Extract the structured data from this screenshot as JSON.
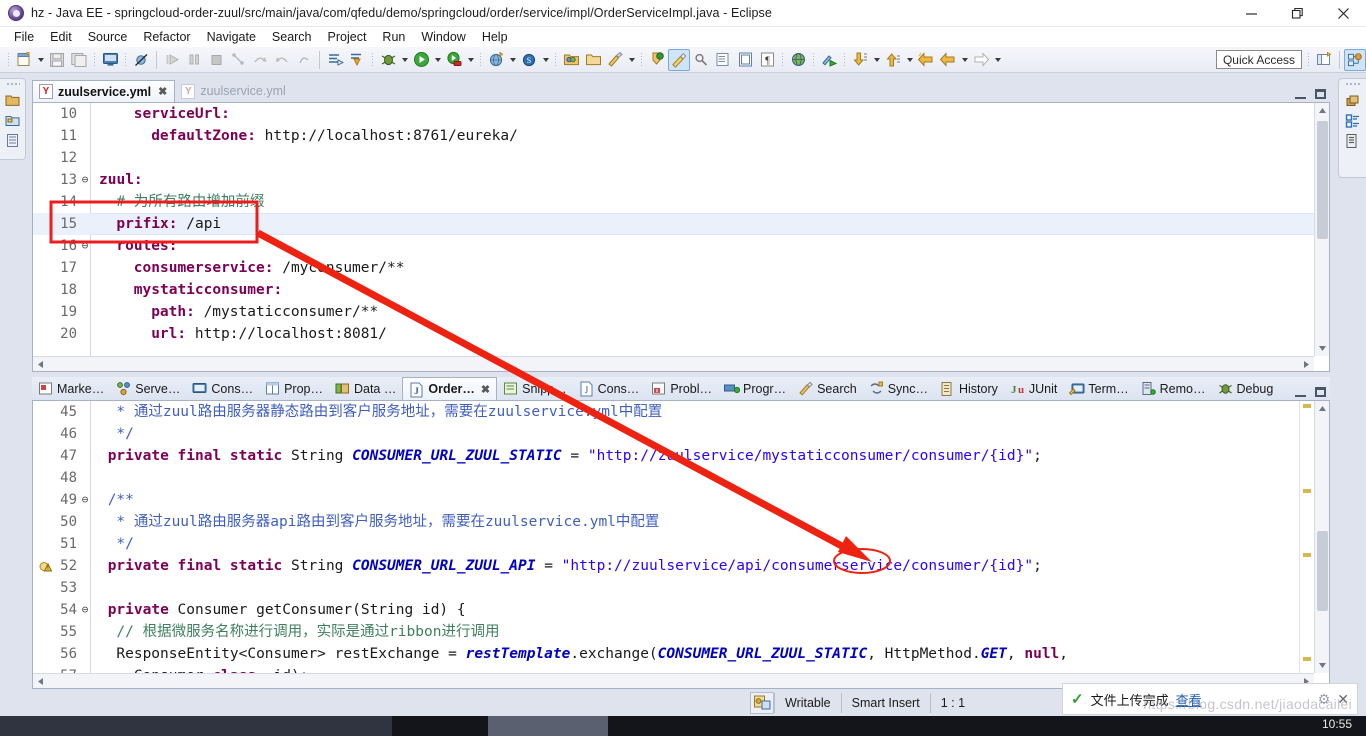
{
  "window": {
    "title": "hz - Java EE - springcloud-order-zuul/src/main/java/com/qfedu/demo/springcloud/order/service/impl/OrderServiceImpl.java - Eclipse",
    "app_icon": "eclipse-icon",
    "minimize_label": "minimize-icon",
    "maximize_label": "restore-icon",
    "close_label": "close-icon"
  },
  "menu": {
    "items": [
      {
        "label": "File"
      },
      {
        "label": "Edit"
      },
      {
        "label": "Source"
      },
      {
        "label": "Refactor"
      },
      {
        "label": "Navigate"
      },
      {
        "label": "Search"
      },
      {
        "label": "Project"
      },
      {
        "label": "Run"
      },
      {
        "label": "Window"
      },
      {
        "label": "Help"
      }
    ]
  },
  "toolbar": {
    "quick_access_label": "Quick Access",
    "buttons": [
      {
        "name": "new-wizard-icon"
      },
      {
        "name": "save-icon"
      },
      {
        "name": "save-all-icon"
      },
      {
        "name": "new-java-ee-icon"
      },
      {
        "name": "skip-all-breakpoints-icon"
      },
      {
        "name": "resume-icon"
      },
      {
        "name": "suspend-icon"
      },
      {
        "name": "terminate-icon"
      },
      {
        "name": "step-into-icon"
      },
      {
        "name": "step-over-icon"
      },
      {
        "name": "step-return-icon"
      },
      {
        "name": "drop-to-frame-icon"
      },
      {
        "name": "next-annotation-icon"
      },
      {
        "name": "previous-annotation-icon"
      },
      {
        "name": "debug-icon"
      },
      {
        "name": "run-icon"
      },
      {
        "name": "run-configurations-icon"
      },
      {
        "name": "new-web-project-icon"
      },
      {
        "name": "new-spring-element-icon"
      },
      {
        "name": "open-type-icon"
      },
      {
        "name": "open-task-icon"
      },
      {
        "name": "external-tools-icon"
      },
      {
        "name": "pin-editor-icon"
      },
      {
        "name": "toggle-mark-occurrences-icon"
      },
      {
        "name": "search-icon"
      },
      {
        "name": "open-perspective-icon"
      },
      {
        "name": "java-ee-perspective-icon"
      }
    ]
  },
  "left_fast_view": {
    "icons": [
      "project-explorer-icon",
      "package-explorer-icon",
      "servers-icon"
    ]
  },
  "right_fast_view": {
    "icons": [
      "restore-view-icon",
      "outline-icon",
      "task-list-icon"
    ]
  },
  "editor": {
    "tabs": [
      {
        "label": "zuulservice.yml",
        "icon": "yaml-file-icon",
        "selected": true,
        "closable": true
      },
      {
        "label": "zuulservice.yml",
        "icon": "yaml-file-icon",
        "selected": false,
        "closable": false
      }
    ],
    "minimize_tooltip": "Minimize",
    "maximize_tooltip": "Maximize",
    "lines": [
      {
        "no": "10",
        "fold": "",
        "indent": 4,
        "segs": [
          {
            "t": "serviceUrl:",
            "c": "k"
          }
        ]
      },
      {
        "no": "11",
        "fold": "",
        "indent": 6,
        "segs": [
          {
            "t": "defaultZone:",
            "c": "k"
          },
          {
            "t": " http://localhost:8761/eureka/",
            "c": "v"
          }
        ]
      },
      {
        "no": "12",
        "fold": "",
        "indent": 0,
        "segs": []
      },
      {
        "no": "13",
        "fold": "⊖",
        "indent": 0,
        "segs": [
          {
            "t": "zuul:",
            "c": "k"
          }
        ]
      },
      {
        "no": "14",
        "fold": "",
        "indent": 2,
        "segs": [
          {
            "t": "# 为所有路由增加前缀",
            "c": "cm"
          }
        ]
      },
      {
        "no": "15",
        "fold": "",
        "indent": 2,
        "segs": [
          {
            "t": "prifix:",
            "c": "k"
          },
          {
            "t": " /api",
            "c": "v"
          }
        ],
        "highlight": true
      },
      {
        "no": "16",
        "fold": "⊖",
        "indent": 2,
        "segs": [
          {
            "t": "routes:",
            "c": "k"
          }
        ]
      },
      {
        "no": "17",
        "fold": "",
        "indent": 4,
        "segs": [
          {
            "t": "consumerservice:",
            "c": "k"
          },
          {
            "t": " /myconsumer/**",
            "c": "v"
          }
        ]
      },
      {
        "no": "18",
        "fold": "",
        "indent": 4,
        "segs": [
          {
            "t": "mystaticconsumer:",
            "c": "k"
          }
        ]
      },
      {
        "no": "19",
        "fold": "",
        "indent": 6,
        "segs": [
          {
            "t": "path:",
            "c": "k"
          },
          {
            "t": " /mystaticconsumer/**",
            "c": "v"
          }
        ]
      },
      {
        "no": "20",
        "fold": "",
        "indent": 6,
        "segs": [
          {
            "t": "url:",
            "c": "k"
          },
          {
            "t": " http://localhost:8081/",
            "c": "v"
          }
        ]
      }
    ]
  },
  "bottom_panel": {
    "tabs": [
      {
        "label": "Marke…",
        "icon": "markers-icon",
        "selected": false
      },
      {
        "label": "Serve…",
        "icon": "servers-icon",
        "selected": false
      },
      {
        "label": "Cons…",
        "icon": "console-icon",
        "selected": false
      },
      {
        "label": "Prop…",
        "icon": "properties-icon",
        "selected": false
      },
      {
        "label": "Data …",
        "icon": "data-source-explorer-icon",
        "selected": false
      },
      {
        "label": "Order…",
        "icon": "java-file-icon",
        "selected": true,
        "closable": true
      },
      {
        "label": "Snipp…",
        "icon": "snippets-icon",
        "selected": false
      },
      {
        "label": "Cons…",
        "icon": "console-java-icon",
        "selected": false
      },
      {
        "label": "Probl…",
        "icon": "problems-icon",
        "selected": false
      },
      {
        "label": "Progr…",
        "icon": "progress-icon",
        "selected": false
      },
      {
        "label": "Search",
        "icon": "search-view-icon",
        "selected": false
      },
      {
        "label": "Sync…",
        "icon": "synchronize-icon",
        "selected": false
      },
      {
        "label": "History",
        "icon": "history-icon",
        "selected": false
      },
      {
        "label": "JUnit",
        "icon": "junit-icon",
        "selected": false
      },
      {
        "label": "Term…",
        "icon": "terminal-icon",
        "selected": false
      },
      {
        "label": "Remo…",
        "icon": "remote-systems-icon",
        "selected": false
      },
      {
        "label": "Debug",
        "icon": "debug-view-icon",
        "selected": false
      }
    ],
    "lines": [
      {
        "no": "45",
        "fold": "",
        "marker": "",
        "indent": 2,
        "segs": [
          {
            "t": "* 通过zuul路由服务器静态路由到客户服务地址，需要在zuulservice.yml中配置",
            "c": "jdoc"
          }
        ]
      },
      {
        "no": "46",
        "fold": "",
        "marker": "",
        "indent": 2,
        "segs": [
          {
            "t": "*/",
            "c": "jdoc"
          }
        ]
      },
      {
        "no": "47",
        "fold": "",
        "marker": "",
        "indent": 1,
        "segs": [
          {
            "t": "private final static",
            "c": "k"
          },
          {
            "t": " String ",
            "c": "v"
          },
          {
            "t": "CONSUMER_URL_ZUUL_STATIC",
            "c": "fld"
          },
          {
            "t": " = ",
            "c": "v"
          },
          {
            "t": "\"http://zuulservice/mystaticconsumer/consumer/{id}\"",
            "c": "str"
          },
          {
            "t": ";",
            "c": "v"
          }
        ]
      },
      {
        "no": "48",
        "fold": "",
        "marker": "",
        "indent": 0,
        "segs": []
      },
      {
        "no": "49",
        "fold": "⊖",
        "marker": "",
        "indent": 1,
        "segs": [
          {
            "t": "/**",
            "c": "jdoc"
          }
        ]
      },
      {
        "no": "50",
        "fold": "",
        "marker": "",
        "indent": 2,
        "segs": [
          {
            "t": "* 通过zuul路由服务器api路由到客户服务地址，需要在zuulservice.yml中配置",
            "c": "jdoc"
          }
        ]
      },
      {
        "no": "51",
        "fold": "",
        "marker": "",
        "indent": 2,
        "segs": [
          {
            "t": "*/",
            "c": "jdoc"
          }
        ]
      },
      {
        "no": "52",
        "fold": "",
        "marker": "warning-bulb-icon",
        "indent": 1,
        "segs": [
          {
            "t": "private final static",
            "c": "k"
          },
          {
            "t": " String ",
            "c": "v"
          },
          {
            "t": "CONSUMER_URL_ZUUL_API",
            "c": "fld"
          },
          {
            "t": " = ",
            "c": "v"
          },
          {
            "t": "\"http://zuulservice/api/consumerservice/consumer/{id}\"",
            "c": "str"
          },
          {
            "t": ";",
            "c": "v"
          }
        ]
      },
      {
        "no": "53",
        "fold": "",
        "marker": "",
        "indent": 0,
        "segs": []
      },
      {
        "no": "54",
        "fold": "⊖",
        "marker": "",
        "indent": 1,
        "segs": [
          {
            "t": "private",
            "c": "k"
          },
          {
            "t": " Consumer getConsumer(String id) {",
            "c": "v"
          }
        ]
      },
      {
        "no": "55",
        "fold": "",
        "marker": "",
        "indent": 2,
        "segs": [
          {
            "t": "// 根据微服务名称进行调用，实际是通过ribbon进行调用",
            "c": "ccm"
          }
        ]
      },
      {
        "no": "56",
        "fold": "",
        "marker": "",
        "indent": 2,
        "segs": [
          {
            "t": "ResponseEntity<Consumer> restExchange = ",
            "c": "v"
          },
          {
            "t": "restTemplate",
            "c": "fld"
          },
          {
            "t": ".exchange(",
            "c": "v"
          },
          {
            "t": "CONSUMER_URL_ZUUL_STATIC",
            "c": "fld"
          },
          {
            "t": ", HttpMethod.",
            "c": "v"
          },
          {
            "t": "GET",
            "c": "fld"
          },
          {
            "t": ", ",
            "c": "v"
          },
          {
            "t": "null",
            "c": "k"
          },
          {
            "t": ",",
            "c": "v"
          }
        ]
      },
      {
        "no": "57",
        "fold": "",
        "marker": "",
        "indent": 4,
        "segs": [
          {
            "t": "Consumer.",
            "c": "v"
          },
          {
            "t": "class",
            "c": "k"
          },
          {
            "t": ", id);",
            "c": "v"
          }
        ]
      }
    ]
  },
  "statusbar": {
    "writable_label": "Writable",
    "insert_mode_label": "Smart Insert",
    "position_label": "1 : 1",
    "icon_name": "editor-state-icon"
  },
  "toast": {
    "check_icon": "check-icon",
    "message": "文件上传完成",
    "link_label": "查看",
    "settings_icon": "gear-icon",
    "close_icon": "close-icon"
  },
  "watermark": {
    "text": "https://blog.csdn.net/jiaodacailei"
  },
  "taskbar": {
    "clock": "10:55"
  },
  "annotations": {
    "highlight_box_color": "#ee1c1c",
    "arrow_color": "#ee2211",
    "ellipse_color": "#ee2211"
  }
}
